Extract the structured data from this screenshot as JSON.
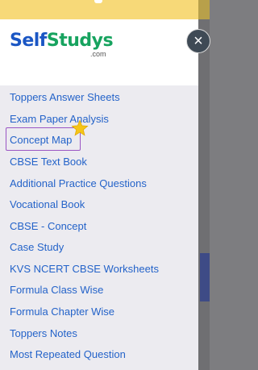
{
  "logo": {
    "part1": "Self",
    "part2": "Studys",
    "domain": ".com"
  },
  "close_icon": "×",
  "menu": {
    "items": [
      {
        "label": "Toppers Answer Sheets"
      },
      {
        "label": "Exam Paper Analysis"
      },
      {
        "label": "Concept Map"
      },
      {
        "label": "CBSE Text Book"
      },
      {
        "label": "Additional Practice Questions"
      },
      {
        "label": "Vocational Book"
      },
      {
        "label": "CBSE - Concept"
      },
      {
        "label": "Case Study"
      },
      {
        "label": "KVS NCERT CBSE Worksheets"
      },
      {
        "label": "Formula Class Wise"
      },
      {
        "label": "Formula Chapter Wise"
      },
      {
        "label": "Toppers Notes"
      },
      {
        "label": "Most Repeated Question"
      }
    ]
  },
  "colors": {
    "link": "#2463c9",
    "logo_blue": "#1a56c4",
    "logo_green": "#17a35f",
    "highlight": "#9a55c4",
    "star": "#f5c518"
  }
}
